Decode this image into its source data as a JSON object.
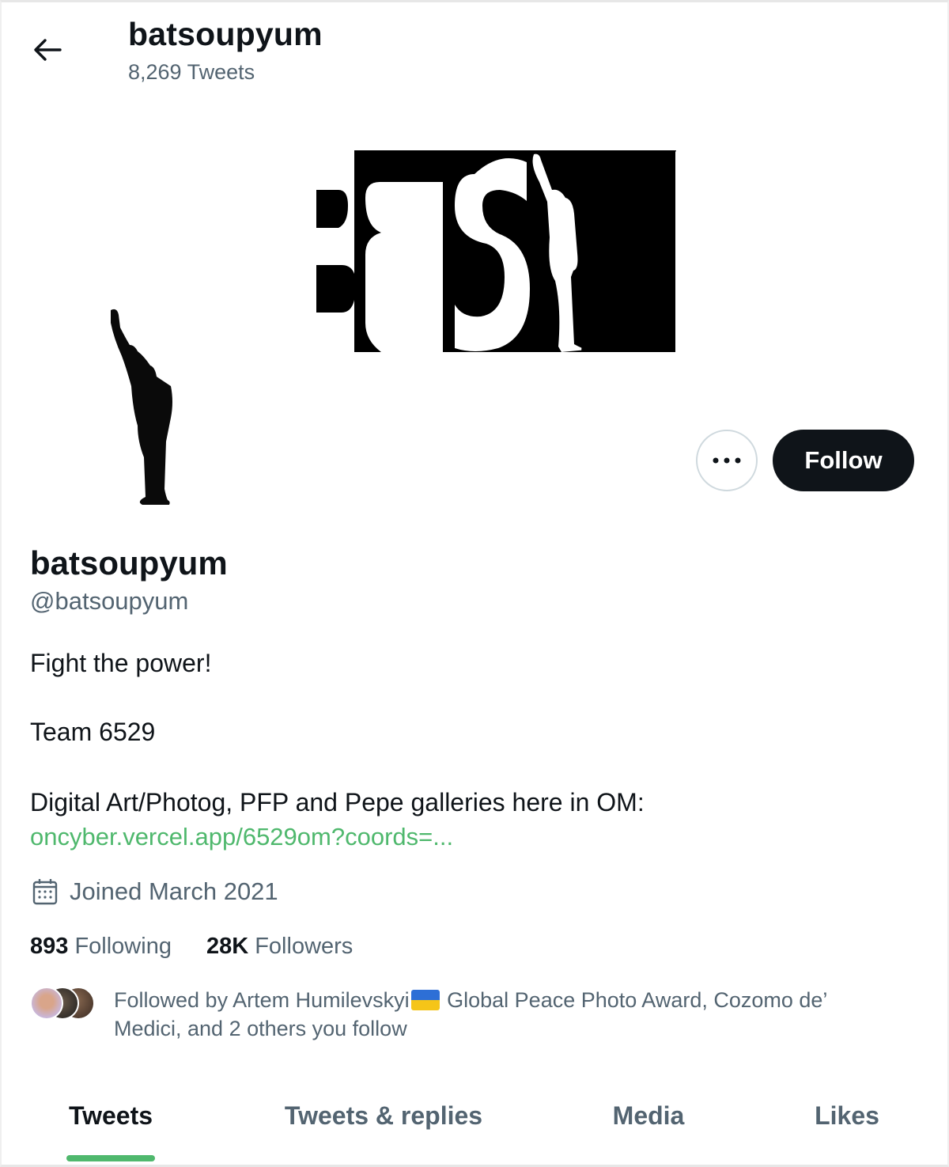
{
  "header": {
    "back_label": "Back",
    "title": "batsoupyum",
    "tweet_count": "8,269 Tweets"
  },
  "banner": {
    "text": "BSY"
  },
  "actions": {
    "more_label": "•••",
    "follow_label": "Follow"
  },
  "profile": {
    "display_name": "batsoupyum",
    "handle": "@batsoupyum",
    "bio": {
      "line1": "Fight the power!",
      "line2": "Team 6529",
      "line3": "Digital Art/Photog, PFP and Pepe galleries here in OM:",
      "link": "oncyber.vercel.app/6529om?coords=..."
    },
    "joined": "Joined March 2021",
    "following_count": "893",
    "following_label": "Following",
    "followers_count": "28K",
    "followers_label": "Followers",
    "followed_by_part1": "Followed by Artem Humilevskyi",
    "followed_by_part2": " Global Peace Photo Award, Cozomo de’ Medici, and 2 others you follow"
  },
  "tabs": [
    {
      "label": "Tweets",
      "active": true
    },
    {
      "label": "Tweets & replies",
      "active": false
    },
    {
      "label": "Media",
      "active": false
    },
    {
      "label": "Likes",
      "active": false
    }
  ],
  "colors": {
    "accent": "#4fb86d",
    "text": "#0f1419",
    "muted": "#536471",
    "border": "#cfd9de"
  }
}
